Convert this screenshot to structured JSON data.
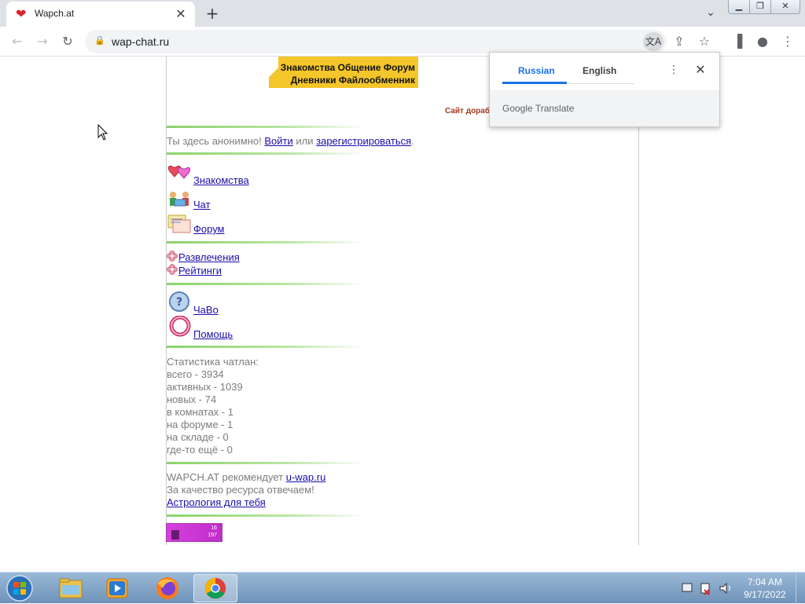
{
  "browser": {
    "tab_title": "Wapch.at",
    "new_tab": "+",
    "url": "wap-chat.ru",
    "window_controls": [
      "minimize",
      "maximize",
      "close"
    ]
  },
  "translate_popup": {
    "lang_source": "Russian",
    "lang_target": "English",
    "footer": "Google Translate"
  },
  "page": {
    "banner_line1": "Знакомства Общение Форум",
    "banner_line2": "Дневники Файлообменник",
    "site_note": "Сайт доработ",
    "anon_text": "Ты здесь анонимно!",
    "login_link": "Войти",
    "or_text": "или",
    "register_link": "зарегистрироваться",
    "period": ".",
    "menu_main": [
      {
        "label": "Знакомства",
        "icon": "hearts-icon"
      },
      {
        "label": "Чат",
        "icon": "chat-people-icon"
      },
      {
        "label": "Форум",
        "icon": "forum-notes-icon"
      }
    ],
    "menu_extra": [
      {
        "label": "Развлечения",
        "icon": "flower-icon"
      },
      {
        "label": "Рейтинги",
        "icon": "flower-icon"
      }
    ],
    "menu_help": [
      {
        "label": "ЧаВо",
        "icon": "question-icon"
      },
      {
        "label": "Помощь",
        "icon": "lifebuoy-icon"
      }
    ],
    "stats": {
      "title": "Статистика чатлан:",
      "lines": [
        "всего - 3934",
        "активных - 1039",
        "новых - 74",
        "в комнатах - 1",
        "на форуме - 1",
        "на складе - 0",
        "где-то ещё - 0"
      ]
    },
    "recommend_prefix": "WAPCH.AT рекомендует",
    "recommend_link": "u-wap.ru",
    "quality_text": "За качество ресурса отвечаем!",
    "astro_link": "Астрология для тебя",
    "badge_top": "16",
    "badge_bottom": "197"
  },
  "taskbar": {
    "time": "7:04 AM",
    "date": "9/17/2022",
    "apps": [
      "explorer",
      "media-player",
      "firefox",
      "chrome"
    ]
  }
}
